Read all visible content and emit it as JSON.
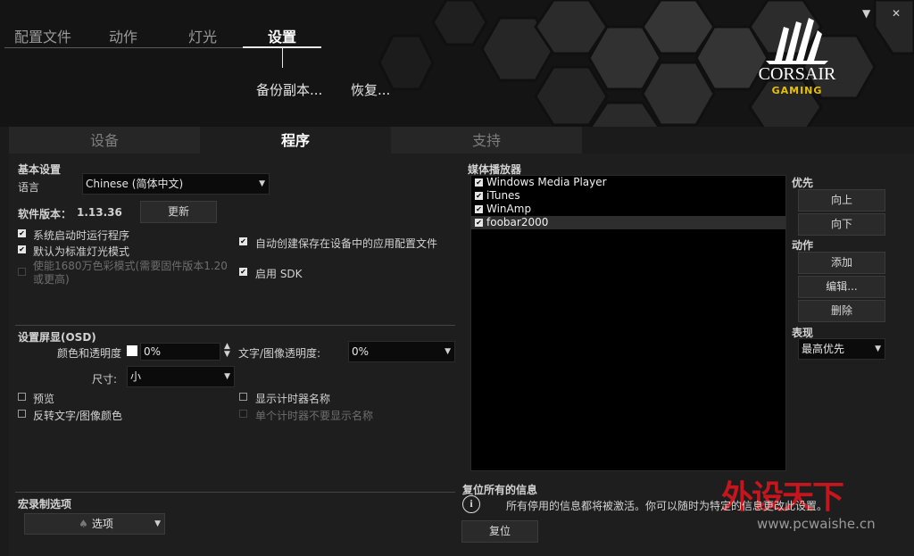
{
  "window": {
    "minimize": "▼",
    "close": "✕"
  },
  "nav": {
    "tabs": [
      "配置文件",
      "动作",
      "灯光",
      "设置"
    ],
    "active": "设置",
    "backup": "备份副本...",
    "restore": "恢复..."
  },
  "brand": {
    "name": "CORSAIR",
    "sub": "GAMING"
  },
  "tabs": [
    "设备",
    "程序",
    "支持"
  ],
  "active_tab": "程序",
  "basic": {
    "title": "基本设置",
    "language_label": "语言",
    "language_value": "Chinese (简体中文)",
    "version_label": "软件版本：",
    "version": "1.13.36",
    "update": "更新",
    "options": [
      {
        "label": "系统启动时运行程序",
        "checked": true,
        "enabled": true
      },
      {
        "label": "默认为标准灯光模式",
        "checked": true,
        "enabled": true
      },
      {
        "label": "使能1680万色彩模式(需要固件版本1.20或更高)",
        "checked": false,
        "enabled": false
      },
      {
        "label": "自动创建保存在设备中的应用配置文件",
        "checked": true,
        "enabled": true
      },
      {
        "label": "启用 SDK",
        "checked": true,
        "enabled": true
      }
    ]
  },
  "osd": {
    "title": "设置屏显(OSD)",
    "color_label": "颜色和透明度",
    "color_value": "0%",
    "text_opacity_label": "文字/图像透明度:",
    "text_opacity_value": "0%",
    "size_label": "尺寸:",
    "size_value": "小",
    "preview": "预览",
    "invert": "反转文字/图像颜色",
    "show_timer_name": "显示计时器名称",
    "single_timer_hide": "单个计时器不要显示名称"
  },
  "macro": {
    "title": "宏录制选项",
    "options_btn": "选项"
  },
  "media": {
    "title": "媒体播放器",
    "players": [
      "Windows Media Player",
      "iTunes",
      "WinAmp",
      "foobar2000"
    ],
    "selected": "foobar2000",
    "priority_label": "优先",
    "up": "向上",
    "down": "向下",
    "action_label": "动作",
    "add": "添加",
    "edit": "编辑...",
    "delete": "删除",
    "performance_label": "表现",
    "performance_value": "最高优先"
  },
  "reset": {
    "title": "复位所有的信息",
    "desc": "所有停用的信息都将被激活。你可以随时为特定的信息更改此设置。",
    "button": "复位"
  },
  "watermark": {
    "text": "外设天下",
    "url": "www.pcwaishe.cn"
  }
}
